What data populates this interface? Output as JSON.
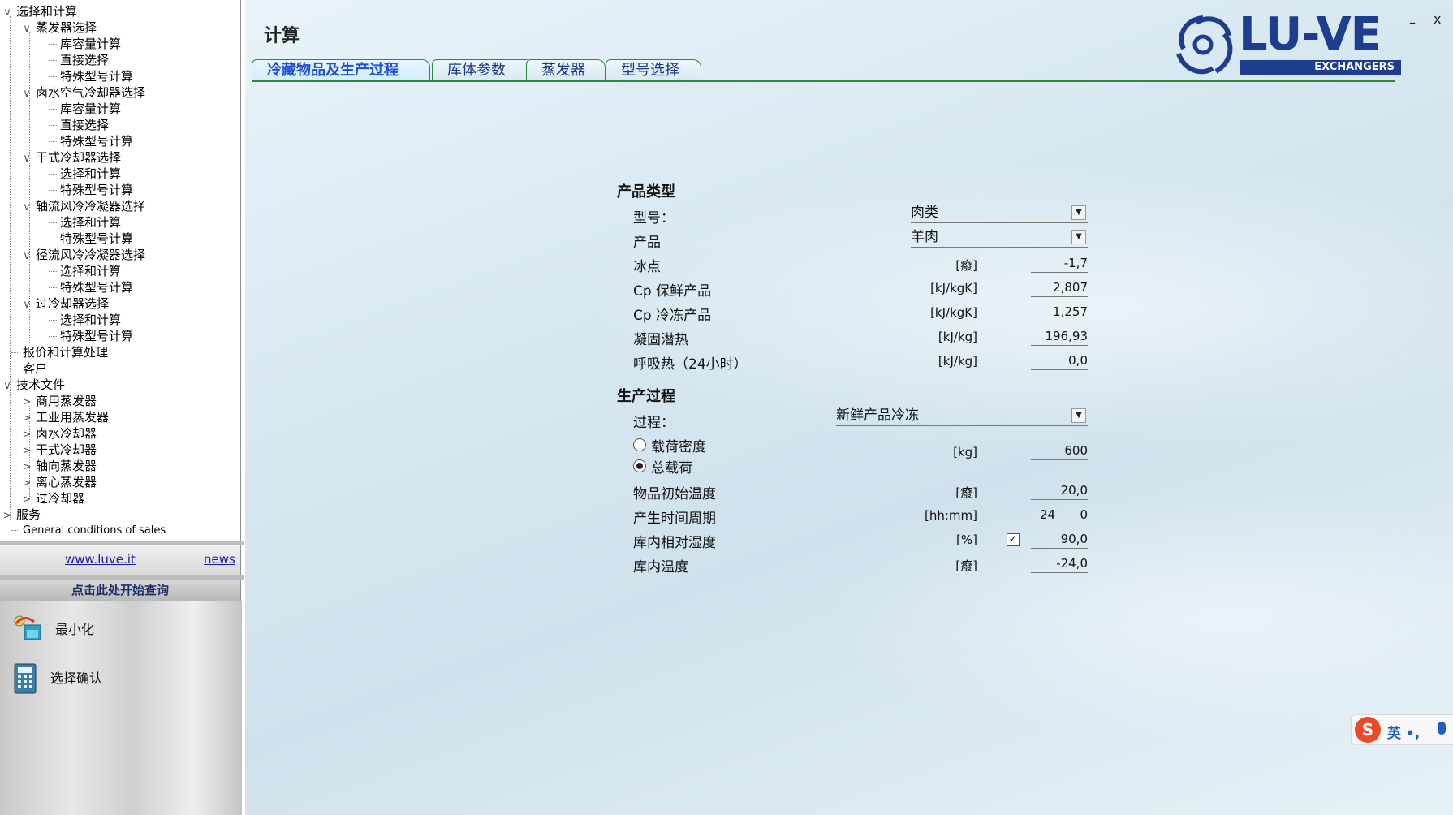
{
  "sidebar": {
    "tree": [
      {
        "label": "选择和计算",
        "toggle": "∨"
      },
      {
        "label": "蒸发器选择",
        "toggle": "∨"
      },
      {
        "label": "库容量计算"
      },
      {
        "label": "直接选择"
      },
      {
        "label": "特殊型号计算"
      },
      {
        "label": "卤水空气冷却器选择",
        "toggle": "∨"
      },
      {
        "label": "库容量计算"
      },
      {
        "label": "直接选择"
      },
      {
        "label": "特殊型号计算"
      },
      {
        "label": "干式冷却器选择",
        "toggle": "∨"
      },
      {
        "label": "选择和计算"
      },
      {
        "label": "特殊型号计算"
      },
      {
        "label": "轴流风冷冷凝器选择",
        "toggle": "∨"
      },
      {
        "label": "选择和计算"
      },
      {
        "label": "特殊型号计算"
      },
      {
        "label": "径流风冷冷凝器选择",
        "toggle": "∨"
      },
      {
        "label": "选择和计算"
      },
      {
        "label": "特殊型号计算"
      },
      {
        "label": "过冷却器选择",
        "toggle": "∨"
      },
      {
        "label": "选择和计算"
      },
      {
        "label": "特殊型号计算"
      },
      {
        "label": "报价和计算处理"
      },
      {
        "label": "客户"
      },
      {
        "label": "技术文件",
        "toggle": "∨"
      },
      {
        "label": "商用蒸发器",
        "toggle": ">"
      },
      {
        "label": "工业用蒸发器",
        "toggle": ">"
      },
      {
        "label": "卤水冷却器",
        "toggle": ">"
      },
      {
        "label": "干式冷却器",
        "toggle": ">"
      },
      {
        "label": "轴向蒸发器",
        "toggle": ">"
      },
      {
        "label": "离心蒸发器",
        "toggle": ">"
      },
      {
        "label": "过冷却器",
        "toggle": ">"
      },
      {
        "label": "服务",
        "toggle": ">"
      },
      {
        "label": "General conditions of sales"
      }
    ],
    "link_site": "www.luve.it",
    "link_news": "news",
    "query_label": "点击此处开始查询",
    "minimize_label": "最小化",
    "confirm_label": "选择确认"
  },
  "header": {
    "title": "计算",
    "tabs": [
      "冷藏物品及生产过程",
      "库体参数",
      "蒸发器",
      "型号选择"
    ],
    "active_tab": 0,
    "logo_text": "LU-VE",
    "logo_sub": "EXCHANGERS",
    "minimize_glyph": "–",
    "close_glyph": "x"
  },
  "product": {
    "section_title": "产品类型",
    "type_label": "型号：",
    "type_value": "肉类",
    "product_label": "产品",
    "product_value": "羊肉",
    "rows": [
      {
        "label": "冰点",
        "unit": "[癈]",
        "value": "-1,7"
      },
      {
        "label": "Cp 保鲜产品",
        "unit": "[kJ/kgK]",
        "value": "2,807"
      },
      {
        "label": "Cp 冷冻产品",
        "unit": "[kJ/kgK]",
        "value": "1,257"
      },
      {
        "label": "凝固潜热",
        "unit": "[kJ/kg]",
        "value": "196,93"
      },
      {
        "label": "呼吸热（24小时）",
        "unit": "[kJ/kg]",
        "value": "0,0"
      }
    ]
  },
  "process": {
    "section_title": "生产过程",
    "process_label": "过程：",
    "process_value": "新鲜产品冷冻",
    "radio_density": "载荷密度",
    "radio_total": "总载荷",
    "load_unit": "[kg]",
    "load_value": "600",
    "initial_temp_label": "物品初始温度",
    "initial_temp_unit": "[癈]",
    "initial_temp_value": "20,0",
    "period_label": "产生时间周期",
    "period_unit": "[hh:mm]",
    "period_hours": "24",
    "period_minutes": "0",
    "humidity_label": "库内相对湿度",
    "humidity_unit": "[%]",
    "humidity_value": "90,0",
    "humidity_checked": true,
    "room_temp_label": "库内温度",
    "room_temp_unit": "[癈]",
    "room_temp_value": "-24,0"
  },
  "ime": {
    "logo": "S",
    "lang": "英 •,"
  },
  "colors": {
    "brand": "#1d3e8f",
    "tab_line": "#2e8a3a",
    "active_tab_text": "#1b4fd6"
  }
}
